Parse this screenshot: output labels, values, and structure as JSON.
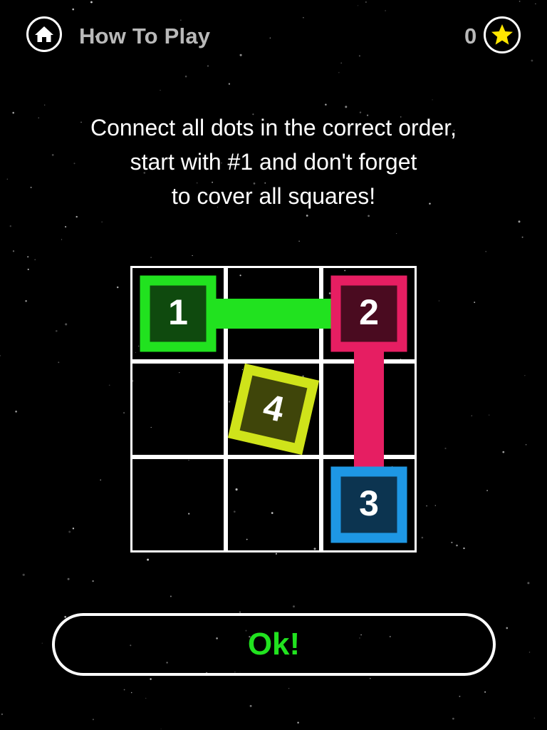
{
  "header": {
    "home_icon": "home-icon",
    "title": "How To Play",
    "star_count": "0",
    "star_icon": "star-icon"
  },
  "instructions": {
    "lines": [
      "Connect all dots in the correct order,",
      "start with #1 and don't forget",
      "to cover all squares!"
    ]
  },
  "board": {
    "rows": 3,
    "cols": 3,
    "dots": [
      {
        "label": "1",
        "row": 0,
        "col": 0,
        "border": "#21e21f",
        "fill": "#0f4a0e",
        "tilted": false
      },
      {
        "label": "2",
        "row": 0,
        "col": 2,
        "border": "#e61e62",
        "fill": "#4a0b20",
        "tilted": false
      },
      {
        "label": "3",
        "row": 2,
        "col": 2,
        "border": "#1e97e4",
        "fill": "#0c3450",
        "tilted": false
      },
      {
        "label": "4",
        "row": 1,
        "col": 1,
        "border": "#cfe31a",
        "fill": "#3f450a",
        "tilted": true
      }
    ],
    "paths": [
      {
        "color": "#21e21f",
        "from": [
          0,
          0
        ],
        "to": [
          0,
          2
        ]
      },
      {
        "color": "#e61e62",
        "from": [
          0,
          2
        ],
        "to": [
          2,
          2
        ]
      }
    ]
  },
  "ok_button": {
    "label": "Ok!"
  },
  "colors": {
    "background": "#000000",
    "grid": "#ffffff",
    "ok_text": "#21e21f",
    "star": "#ffe600"
  }
}
